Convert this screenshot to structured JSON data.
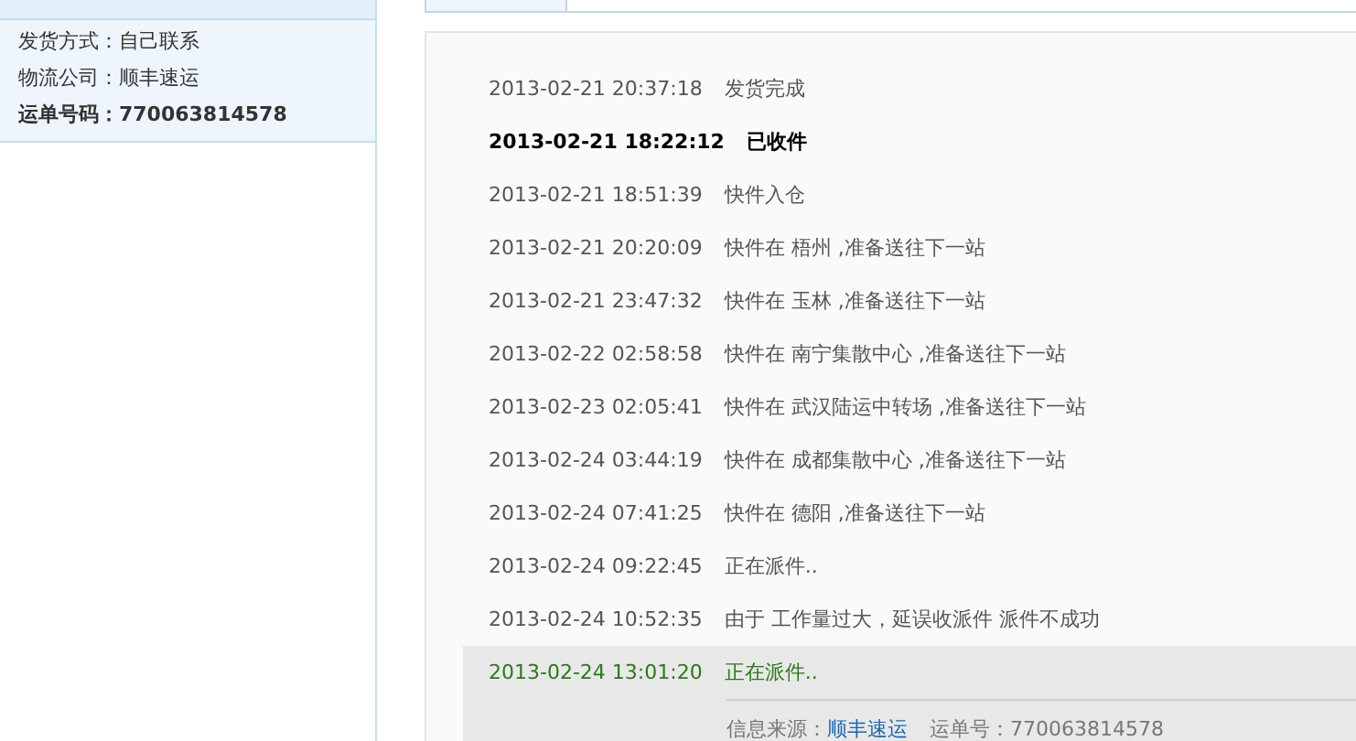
{
  "shipping_info": [
    {
      "label": "发货方式：",
      "value": "自己联系",
      "bold": false
    },
    {
      "label": "物流公司：",
      "value": "顺丰速运",
      "bold": false
    },
    {
      "label": "运单号码：",
      "value": "770063814578",
      "bold": true
    }
  ],
  "tracking": [
    {
      "time": "2013-02-21 20:37:18",
      "status": "发货完成",
      "kind": "normal"
    },
    {
      "time": "2013-02-21 18:22:12",
      "status": "已收件",
      "kind": "emphasis"
    },
    {
      "time": "2013-02-21 18:51:39",
      "status": "快件入仓",
      "kind": "normal"
    },
    {
      "time": "2013-02-21 20:20:09",
      "status": "快件在 梧州 ,准备送往下一站",
      "kind": "normal"
    },
    {
      "time": "2013-02-21 23:47:32",
      "status": "快件在 玉林 ,准备送往下一站",
      "kind": "normal"
    },
    {
      "time": "2013-02-22 02:58:58",
      "status": "快件在 南宁集散中心 ,准备送往下一站",
      "kind": "normal"
    },
    {
      "time": "2013-02-23 02:05:41",
      "status": "快件在 武汉陆运中转场 ,准备送往下一站",
      "kind": "normal"
    },
    {
      "time": "2013-02-24 03:44:19",
      "status": "快件在 成都集散中心 ,准备送往下一站",
      "kind": "normal"
    },
    {
      "time": "2013-02-24 07:41:25",
      "status": "快件在 德阳 ,准备送往下一站",
      "kind": "normal"
    },
    {
      "time": "2013-02-24 09:22:45",
      "status": "正在派件..",
      "kind": "normal"
    },
    {
      "time": "2013-02-24 10:52:35",
      "status": "由于 工作量过大，延误收派件 派件不成功",
      "kind": "normal"
    },
    {
      "time": "2013-02-24 13:01:20",
      "status": "正在派件..",
      "kind": "latest"
    }
  ],
  "source": {
    "label": "信息来源：",
    "link": "顺丰速运",
    "waybill": "运单号：770063814578"
  }
}
